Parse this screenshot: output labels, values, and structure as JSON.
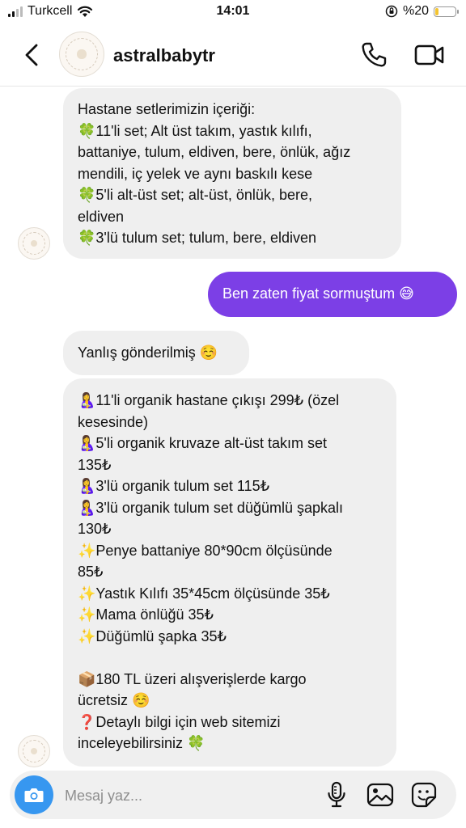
{
  "status_bar": {
    "carrier": "Turkcell",
    "time": "14:01",
    "battery_text": "%20",
    "battery_level_percent": 20,
    "battery_color": "#f4c430"
  },
  "header": {
    "username": "astralbabytr",
    "back_icon": "chevron-left-icon",
    "call_icon": "phone-icon",
    "video_icon": "video-camera-icon"
  },
  "messages": [
    {
      "direction": "incoming",
      "lines": [
        "Hastane setlerimizin içeriği:",
        "🍀11'li set;  Alt üst takım, yastık kılıfı,",
        "battaniye, tulum, eldiven, bere, önlük, ağız",
        "mendili, iç yelek ve aynı baskılı kese",
        "🍀5'li alt-üst set; alt-üst, önlük, bere,",
        "eldiven",
        "🍀3'lü tulum set; tulum, bere, eldiven"
      ]
    },
    {
      "direction": "outgoing",
      "lines": [
        "Ben zaten fiyat sormuştum 😅"
      ]
    },
    {
      "direction": "incoming",
      "lines": [
        "Yanlış gönderilmiş ☺️"
      ]
    },
    {
      "direction": "incoming",
      "lines": [
        "🤱11'li organik hastane çıkışı 299₺ (özel",
        "kesesinde)",
        "🤱5'li organik kruvaze alt-üst takım set",
        "135₺",
        "🤱3'lü organik tulum set 115₺",
        "🤱3'lü organik tulum set düğümlü şapkalı",
        "130₺",
        "✨Penye battaniye 80*90cm ölçüsünde",
        "85₺",
        "✨Yastık Kılıfı 35*45cm ölçüsünde 35₺",
        "✨Mama önlüğü 35₺",
        "✨Düğümlü şapka 35₺",
        "",
        "📦180 TL üzeri alışverişlerde kargo",
        "ücretsiz ☺️",
        "❓Detaylı bilgi için web sitemizi",
        "inceleyebilirsiniz 🍀"
      ]
    }
  ],
  "composer": {
    "placeholder": "Mesaj yaz...",
    "camera_icon": "camera-icon",
    "mic_icon": "microphone-icon",
    "gallery_icon": "gallery-icon",
    "sticker_icon": "sticker-icon"
  },
  "colors": {
    "outgoing_bubble": "#7c3fe6",
    "incoming_bubble": "#efefef",
    "camera_button": "#3797f0"
  }
}
